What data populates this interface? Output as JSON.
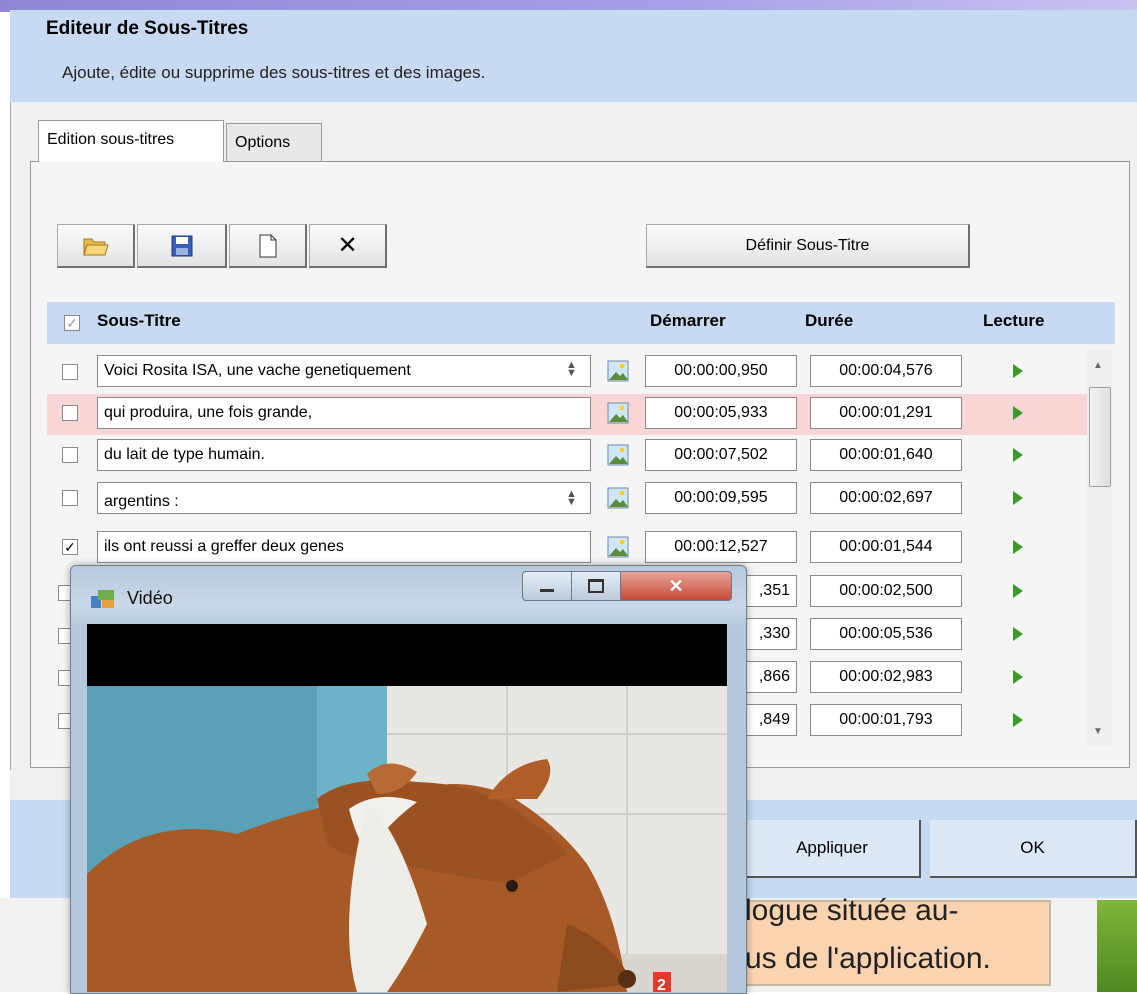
{
  "dialog": {
    "title": "Editeur de Sous-Titres",
    "subtitle": "Ajoute, édite ou supprime des sous-titres et des images."
  },
  "tabs": [
    {
      "label": "Edition sous-titres",
      "active": true
    },
    {
      "label": "Options",
      "active": false
    }
  ],
  "toolbar": {
    "icons": [
      "open-folder-icon",
      "save-icon",
      "new-document-icon",
      "delete-icon"
    ],
    "delete_glyph": "✕",
    "define_label": "Définir Sous-Titre"
  },
  "columns": {
    "subtitle": "Sous-Titre",
    "start": "Démarrer",
    "duration": "Durée",
    "play": "Lecture"
  },
  "rows": [
    {
      "text": "Voici Rosita ISA, une vache genetiquement",
      "checked": false,
      "start": "00:00:00,950",
      "duration": "00:00:04,576"
    },
    {
      "text": "qui produira, une fois grande,",
      "checked": false,
      "start": "00:00:05,933",
      "duration": "00:00:01,291"
    },
    {
      "text": "du lait de type humain.",
      "checked": false,
      "start": "00:00:07,502",
      "duration": "00:00:01,640"
    },
    {
      "text": "argentins :",
      "checked": false,
      "start": "00:00:09,595",
      "duration": "00:00:02,697"
    },
    {
      "text": "ils ont reussi a greffer deux genes",
      "checked": true,
      "start": "00:00:12,527",
      "duration": "00:00:01,544"
    },
    {
      "text": "",
      "checked": false,
      "start": ",351",
      "duration": "00:00:02,500"
    },
    {
      "text": "",
      "checked": false,
      "start": ",330",
      "duration": "00:00:05,536"
    },
    {
      "text": "",
      "checked": false,
      "start": ",866",
      "duration": "00:00:02,983"
    },
    {
      "text": "",
      "checked": false,
      "start": ",849",
      "duration": "00:00:01,793"
    }
  ],
  "buttons": {
    "apply": "Appliquer",
    "ok": "OK"
  },
  "background_slide": {
    "line1": "logue située au-",
    "line2": "us de l'application."
  },
  "video_window": {
    "title": "Vidéo",
    "badge": "2"
  },
  "colors": {
    "header_blue": "#c7daf1",
    "highlight_row": "#f9d6d6",
    "play_green": "#3c9a2a",
    "close_red": "#c9493a"
  }
}
